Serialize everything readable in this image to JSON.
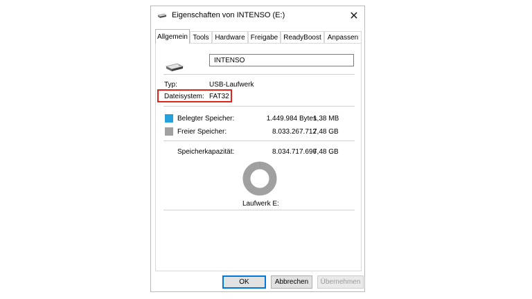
{
  "window": {
    "title": "Eigenschaften von INTENSO (E:)",
    "close_symbol": "✕",
    "title_icon": "usb-drive-icon"
  },
  "tabs": [
    {
      "label": "Allgemein",
      "active": true
    },
    {
      "label": "Tools",
      "active": false
    },
    {
      "label": "Hardware",
      "active": false
    },
    {
      "label": "Freigabe",
      "active": false
    },
    {
      "label": "ReadyBoost",
      "active": false
    },
    {
      "label": "Anpassen",
      "active": false
    }
  ],
  "general": {
    "drive_icon": "usb-drive-icon",
    "name_value": "INTENSO",
    "type_label": "Typ:",
    "type_value": "USB-Laufwerk",
    "fs_label": "Dateisystem:",
    "fs_value": "FAT32",
    "highlight_color": "#e2231a"
  },
  "space": {
    "used": {
      "label": "Belegter Speicher:",
      "bytes": "1.449.984 Bytes",
      "size": "1,38 MB",
      "color": "#26a0da"
    },
    "free": {
      "label": "Freier Speicher:",
      "bytes": "8.033.267.712",
      "size": "7,48 GB",
      "color": "#a0a0a0"
    },
    "capacity": {
      "label": "Speicherkapazität:",
      "bytes": "8.034.717.696",
      "size": "7,48 GB"
    },
    "used_fraction": 0.00018,
    "drive_label": "Laufwerk E:"
  },
  "buttons": {
    "ok": "OK",
    "cancel": "Abbrechen",
    "apply": "Übernehmen"
  }
}
